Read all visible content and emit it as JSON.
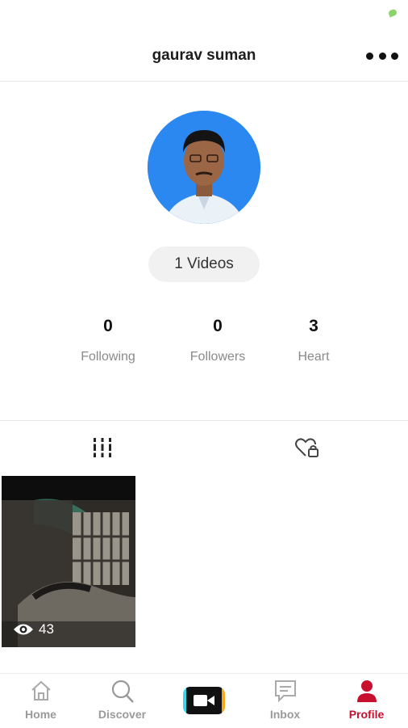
{
  "header": {
    "title": "gaurav suman"
  },
  "profile": {
    "videos_label": "1 Videos"
  },
  "stats": [
    {
      "value": "0",
      "label": "Following"
    },
    {
      "value": "0",
      "label": "Followers"
    },
    {
      "value": "3",
      "label": "Heart"
    }
  ],
  "grid": {
    "videos": [
      {
        "views": "43"
      }
    ]
  },
  "bottom_nav": {
    "items": [
      {
        "label": "Home",
        "icon": "home-icon"
      },
      {
        "label": "Discover",
        "icon": "search-icon"
      },
      {
        "label": "",
        "icon": "video-camera-icon"
      },
      {
        "label": "Inbox",
        "icon": "message-icon"
      },
      {
        "label": "Profile",
        "icon": "person-icon"
      }
    ]
  },
  "colors": {
    "accent": "#c8102e",
    "avatar_bg": "#2a88f0",
    "record_left": "#3bd6e8",
    "record_right": "#f7a81b"
  }
}
